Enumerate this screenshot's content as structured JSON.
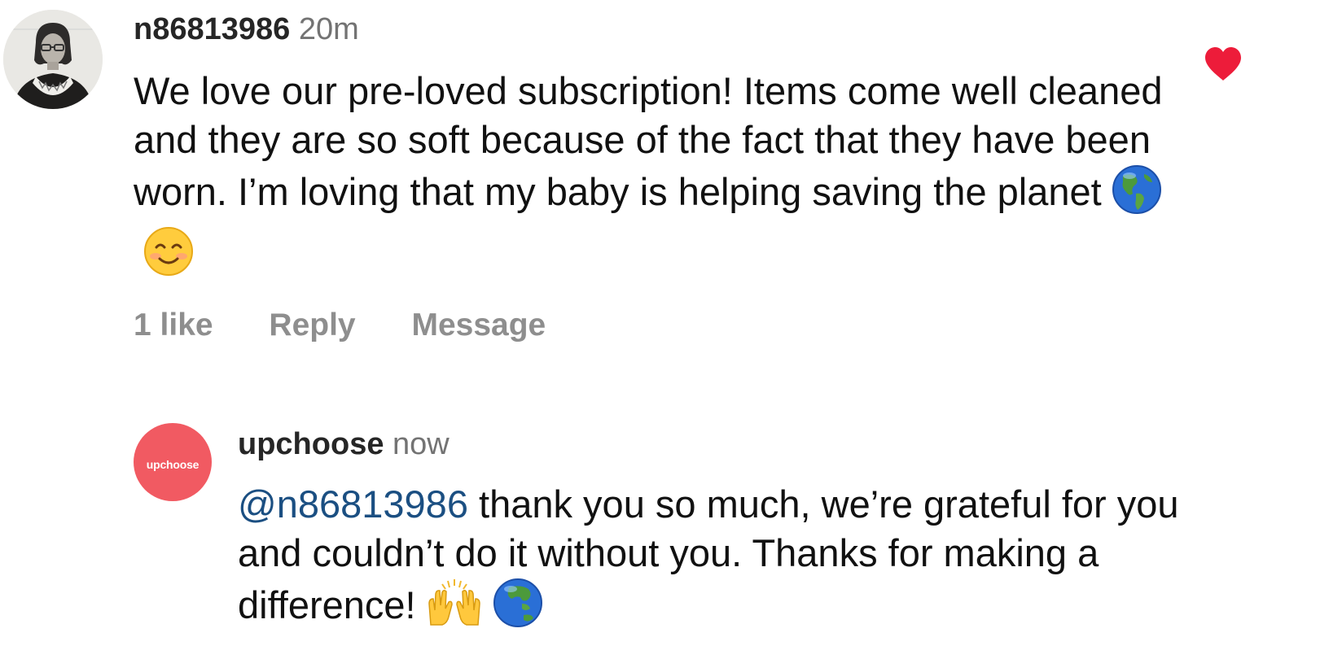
{
  "comments": [
    {
      "username": "n86813986",
      "timestamp": "20m",
      "text": "We love our pre-loved subscription! Items come well cleaned and they are so soft because of the fact that they have been worn. I’m loving that my baby is helping saving the planet",
      "emojis": [
        "globe-americas-icon",
        "smiling-face-icon"
      ],
      "likes_label": "1 like",
      "reply_label": "Reply",
      "message_label": "Message",
      "liked": true,
      "heart_color": "#ed1c3a"
    },
    {
      "username": "upchoose",
      "timestamp": "now",
      "avatar_text": "upchoose",
      "avatar_color": "#f15a62",
      "mention": "@n86813986",
      "text": " thank you so much, we’re grateful for you and couldn’t do it without you. Thanks for making a difference!",
      "mention_color": "#1b4f82",
      "emojis": [
        "raising-hands-icon",
        "globe-asia-icon"
      ]
    }
  ]
}
